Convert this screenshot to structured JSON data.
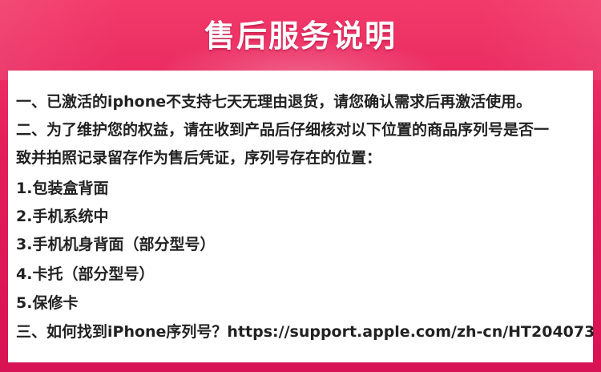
{
  "title": "售后服务说明",
  "lines": [
    "一、已激活的iphone不支持七天无理由退货，请您确认需求后再激活使用。",
    "二、为了维护您的权益，请在收到产品后仔细核对以下位置的商品序列号是否一",
    "致并拍照记录留存作为售后凭证，序列号存在的位置：",
    "1.包装盒背面",
    "2.手机系统中",
    "3.手机机身背面（部分型号）",
    "4.卡托（部分型号）",
    "5.保修卡",
    "三、如何找到iPhone序列号？https://support.apple.com/zh-cn/HT204073"
  ],
  "colors": {
    "banner": "#e31e5a",
    "panel": "#ffffff",
    "text": "#222222"
  }
}
